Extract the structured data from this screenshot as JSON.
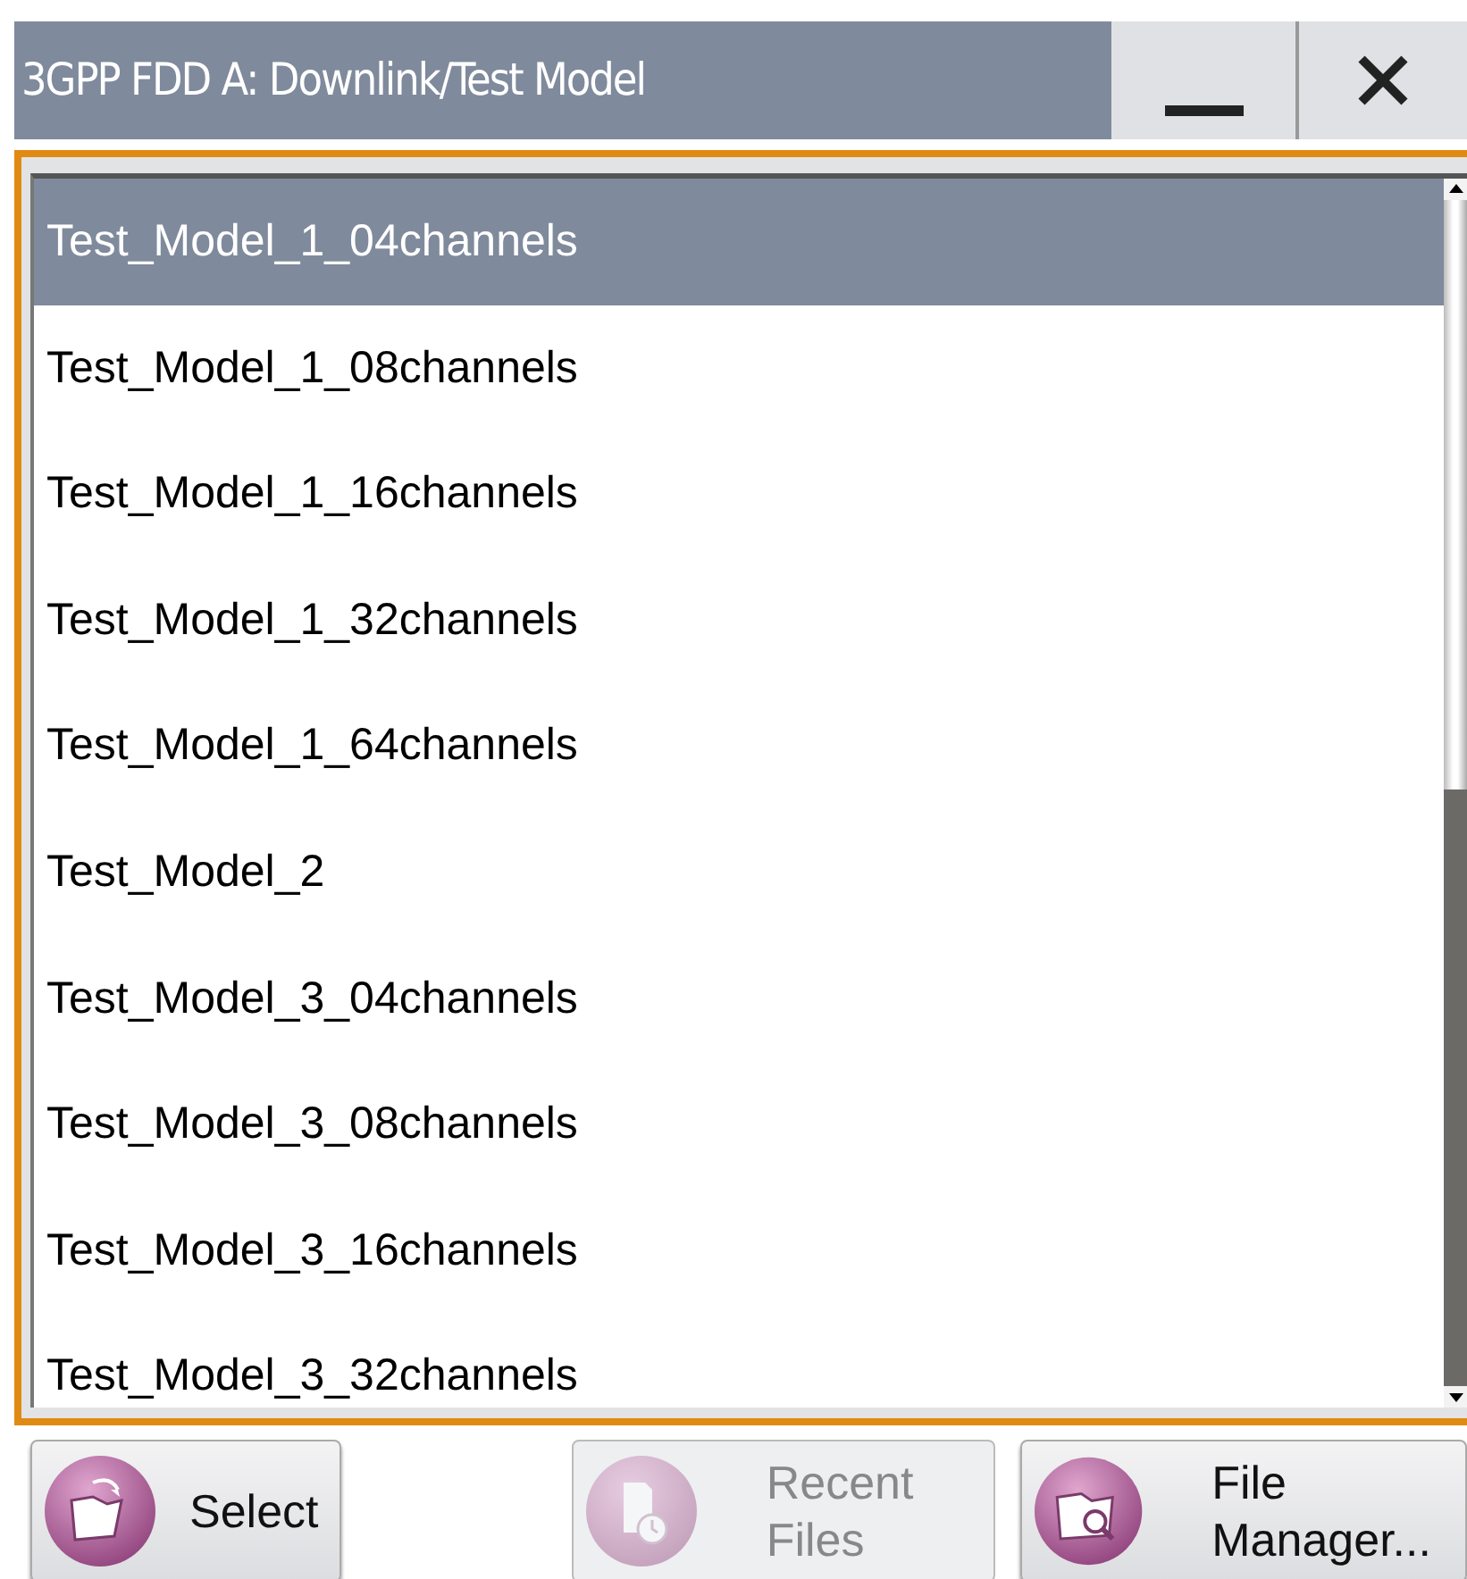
{
  "window": {
    "title": "3GPP FDD A: Downlink/Test Model"
  },
  "title_buttons": [
    {
      "kind": "minimize"
    },
    {
      "kind": "close"
    }
  ],
  "list": {
    "items": [
      {
        "label": "Test_Model_1_04channels",
        "selected": true
      },
      {
        "label": "Test_Model_1_08channels",
        "selected": false
      },
      {
        "label": "Test_Model_1_16channels",
        "selected": false
      },
      {
        "label": "Test_Model_1_32channels",
        "selected": false
      },
      {
        "label": "Test_Model_1_64channels",
        "selected": false
      },
      {
        "label": "Test_Model_2",
        "selected": false
      },
      {
        "label": "Test_Model_3_04channels",
        "selected": false
      },
      {
        "label": "Test_Model_3_08channels",
        "selected": false
      },
      {
        "label": "Test_Model_3_16channels",
        "selected": false
      },
      {
        "label": "Test_Model_3_32channels",
        "selected": false
      }
    ]
  },
  "buttons": [
    {
      "label": "Select",
      "kind": "select",
      "disabled": false
    },
    {
      "label": "Recent Files",
      "kind": "recent",
      "disabled": true
    },
    {
      "label": "File Manager...",
      "kind": "manager",
      "disabled": false
    }
  ]
}
